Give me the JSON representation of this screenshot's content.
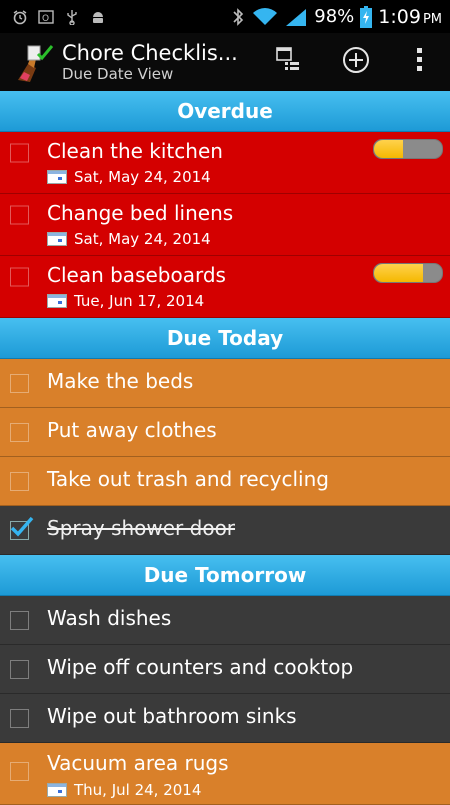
{
  "status_bar": {
    "battery_percent": "98%",
    "time": "1:09",
    "ampm": "PM",
    "icons": [
      "alarm-icon",
      "outlook-icon",
      "usb-icon",
      "android-icon",
      "bluetooth-icon",
      "wifi-icon",
      "signal-icon",
      "battery-icon"
    ]
  },
  "action_bar": {
    "title": "Chore Checklis...",
    "subtitle": "Due Date View",
    "actions": [
      "calendar-list-icon",
      "add-circle-icon",
      "overflow-menu-icon"
    ]
  },
  "sections": {
    "overdue": {
      "label": "Overdue",
      "tasks": [
        {
          "title": "Clean the kitchen",
          "due": "Sat, May 24, 2014",
          "progress": 0.42
        },
        {
          "title": "Change bed linens",
          "due": "Sat, May 24, 2014"
        },
        {
          "title": "Clean baseboards",
          "due": "Tue, Jun 17, 2014",
          "progress": 0.72
        }
      ]
    },
    "today": {
      "label": "Due Today",
      "tasks": [
        {
          "title": "Make the beds"
        },
        {
          "title": "Put away clothes"
        },
        {
          "title": "Take out trash and recycling"
        },
        {
          "title": "Spray shower door",
          "checked": true
        }
      ]
    },
    "tomorrow": {
      "label": "Due Tomorrow",
      "tasks": [
        {
          "title": "Wash dishes"
        },
        {
          "title": "Wipe off counters and cooktop"
        },
        {
          "title": "Wipe out bathroom sinks"
        },
        {
          "title": "Vacuum area rugs",
          "due": "Thu, Jul 24, 2014"
        }
      ]
    }
  },
  "colors": {
    "overdue_row": "#d40000",
    "today_row": "#d9802a",
    "completed_row": "#3a3a3a",
    "section_header": "#2aa9e3",
    "progress_fill": "#f5b800"
  }
}
